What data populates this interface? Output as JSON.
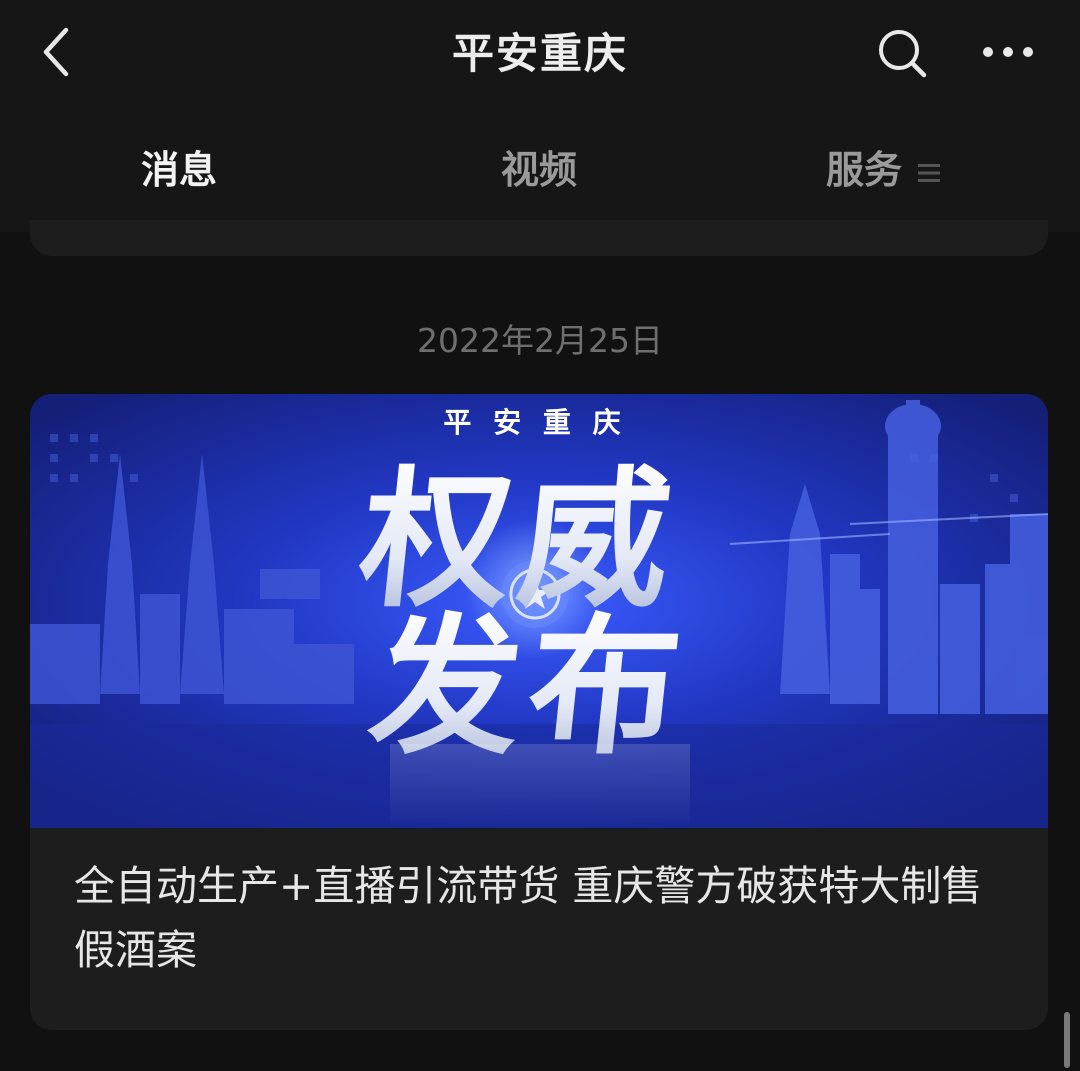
{
  "header": {
    "title": "平安重庆",
    "back_icon": "chevron-left-icon",
    "search_icon": "search-icon",
    "more_icon": "more-dots-icon"
  },
  "tabs": [
    {
      "label": "消息",
      "active": true
    },
    {
      "label": "视频",
      "active": false
    },
    {
      "label": "服务",
      "active": false,
      "icon": "menu-icon"
    }
  ],
  "feed": {
    "date": "2022年2月25日",
    "article": {
      "banner": {
        "brand": "平 安 重 庆",
        "line1": "权威",
        "line2": "发布"
      },
      "headline": "全自动生产+直播引流带货 重庆警方破获特大制售假酒案"
    }
  },
  "colors": {
    "background": "#111111",
    "card": "#1d1d1d",
    "banner_blue": "#1f36b8",
    "text_primary": "#e6e6e6",
    "text_secondary": "#9a9a9a",
    "date_text": "#6f6f6f"
  }
}
